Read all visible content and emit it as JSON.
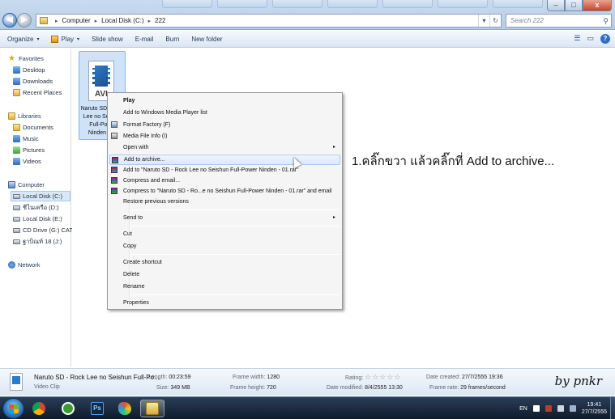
{
  "window": {
    "controls": {
      "minimize": "–",
      "maximize": "□",
      "close": "x"
    }
  },
  "address_bar": {
    "crumbs": [
      "Computer",
      "Local Disk (C:)",
      "222"
    ],
    "separator": "▸",
    "dropdown": "▾",
    "refresh": "↻"
  },
  "search": {
    "placeholder": "Search 222",
    "icon": "search-icon"
  },
  "toolbar": {
    "organize": "Organize",
    "play": "Play",
    "slide_show": "Slide show",
    "email": "E-mail",
    "burn": "Burn",
    "new_folder": "New folder",
    "dropdown_arrow": "▾",
    "view_glyph": "☰",
    "pane_glyph": "▭",
    "help_glyph": "?"
  },
  "nav": {
    "favorites": "Favorites",
    "desktop": "Desktop",
    "downloads": "Downloads",
    "recent_places": "Recent Places",
    "libraries": "Libraries",
    "documents": "Documents",
    "music": "Music",
    "pictures": "Pictures",
    "videos": "Videos",
    "computer": "Computer",
    "local_disk_c": "Local Disk (C:)",
    "drive_d": "ชีไนเครือ (D:)",
    "local_disk_e": "Local Disk (E:)",
    "cd_drive_g": "CD Drive (G:) CAT C",
    "drive_j": "ฐาบิณท์ 18 (J:)",
    "network": "Network"
  },
  "file": {
    "ext": "AVI",
    "name": "Naruto SD - Rock Lee no Seishun Full-Power Ninden - 01"
  },
  "context_menu": {
    "play": "Play",
    "add_wmp": "Add to Windows Media Player list",
    "format_factory": "Format Factory (F)",
    "media_info": "Media File Info (I)",
    "open_with": "Open with",
    "add_archive": "Add to archive...",
    "add_rar": "Add to \"Naruto SD - Rock Lee no Seishun Full-Power Ninden - 01.rar\"",
    "compress_email": "Compress and email...",
    "compress_rar_email": "Compress to \"Naruto SD - Ro...e no Seishun Full-Power Ninden - 01.rar\" and email",
    "restore": "Restore previous versions",
    "send_to": "Send to",
    "cut": "Cut",
    "copy": "Copy",
    "create_shortcut": "Create shortcut",
    "delete": "Delete",
    "rename": "Rename",
    "properties": "Properties",
    "submenu_arrow": "▸"
  },
  "annotation": "1.คลิ๊กขวา แล้วคลิ๊กที่ Add to archive...",
  "details": {
    "name": "Naruto SD - Rock Lee no Seishun Full-Po...",
    "type": "Video Clip",
    "length_label": "Length:",
    "length": "00:23:59",
    "size_label": "Size:",
    "size": "349 MB",
    "frame_width_label": "Frame width:",
    "frame_width": "1280",
    "frame_height_label": "Frame height:",
    "frame_height": "720",
    "rating_label": "Rating:",
    "rating_stars": "☆☆☆☆☆",
    "date_modified_label": "Date modified:",
    "date_modified": "8/4/2555 13:30",
    "date_created_label": "Date created:",
    "date_created": "27/7/2555 19:36",
    "frame_rate_label": "Frame rate:",
    "frame_rate": "29 frames/second",
    "signature": "by pnkr"
  },
  "taskbar": {
    "ps_label": "Ps",
    "lang": "EN",
    "time": "19:41",
    "date": "27/7/2555"
  }
}
